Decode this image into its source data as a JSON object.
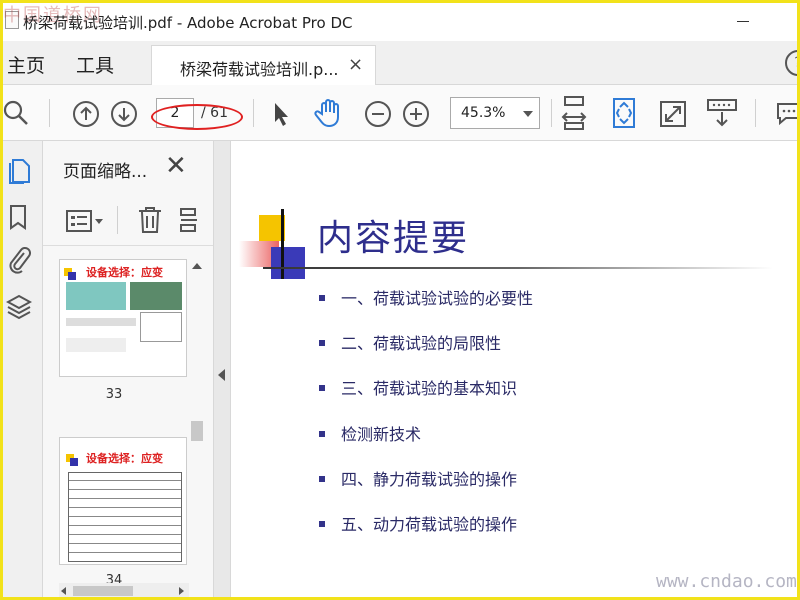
{
  "window": {
    "title": "桥梁荷载试验培训.pdf - Adobe Acrobat Pro DC",
    "watermark_top": "中国道桥网"
  },
  "tabs": {
    "home": "主页",
    "tools": "工具",
    "document_tab": "桥梁荷载试验培训.p...",
    "close_glyph": "×",
    "help_glyph": "?"
  },
  "toolbar": {
    "current_page": "2",
    "total_pages": "/ 61",
    "zoom": "45.3%"
  },
  "thumbnail_panel": {
    "title": "页面缩略...",
    "close_glyph": "✕",
    "thumbnails": [
      {
        "number": "33",
        "heading": "设备选择：应变"
      },
      {
        "number": "34",
        "heading": "设备选择：应变"
      }
    ]
  },
  "slide": {
    "title": "内容提要",
    "bullets": [
      "一、荷载试验试验的必要性",
      "二、荷载试验的局限性",
      "三、荷载试验的基本知识",
      "检测新技术",
      "四、静力荷载试验的操作",
      "五、动力荷载试验的操作"
    ],
    "watermark": "www.cndao.com"
  },
  "colors": {
    "accent_blue": "#2f7bd6",
    "title_blue": "#2e2e8c",
    "annotation_red": "#e02020",
    "frame_yellow": "#f2e21a"
  }
}
